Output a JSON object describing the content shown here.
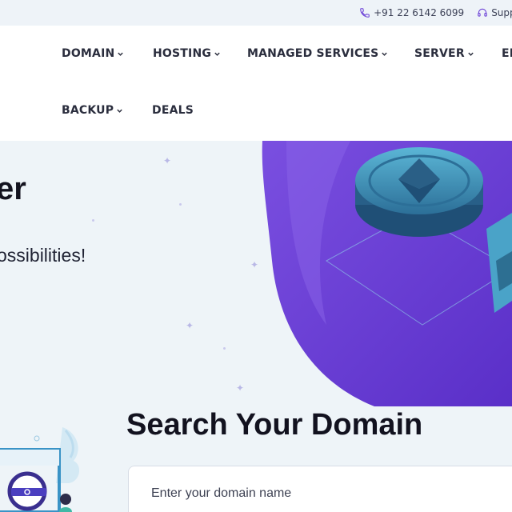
{
  "topbar": {
    "phone": "+91 22 6142 6099",
    "support": "Suppo",
    "phone_icon": "phone-icon",
    "support_icon": "headset-icon"
  },
  "nav": {
    "items": [
      {
        "label": "DOMAIN",
        "has_dropdown": true
      },
      {
        "label": "HOSTING",
        "has_dropdown": true
      },
      {
        "label": "MANAGED SERVICES",
        "has_dropdown": true
      },
      {
        "label": "SERVER",
        "has_dropdown": true
      },
      {
        "label": "EI",
        "has_dropdown": false
      },
      {
        "label": "BACKUP",
        "has_dropdown": true
      },
      {
        "label": "DEALS",
        "has_dropdown": false
      }
    ]
  },
  "hero": {
    "title": "er",
    "subtitle": "ossibilities!"
  },
  "search": {
    "title": "Search Your Domain",
    "placeholder": "Enter your domain name"
  },
  "colors": {
    "accent_purple": "#6a3fd6",
    "coin_blue": "#3f8fb6",
    "hero_bg": "#eef4f8",
    "topbar_bg": "#eef3f8"
  }
}
